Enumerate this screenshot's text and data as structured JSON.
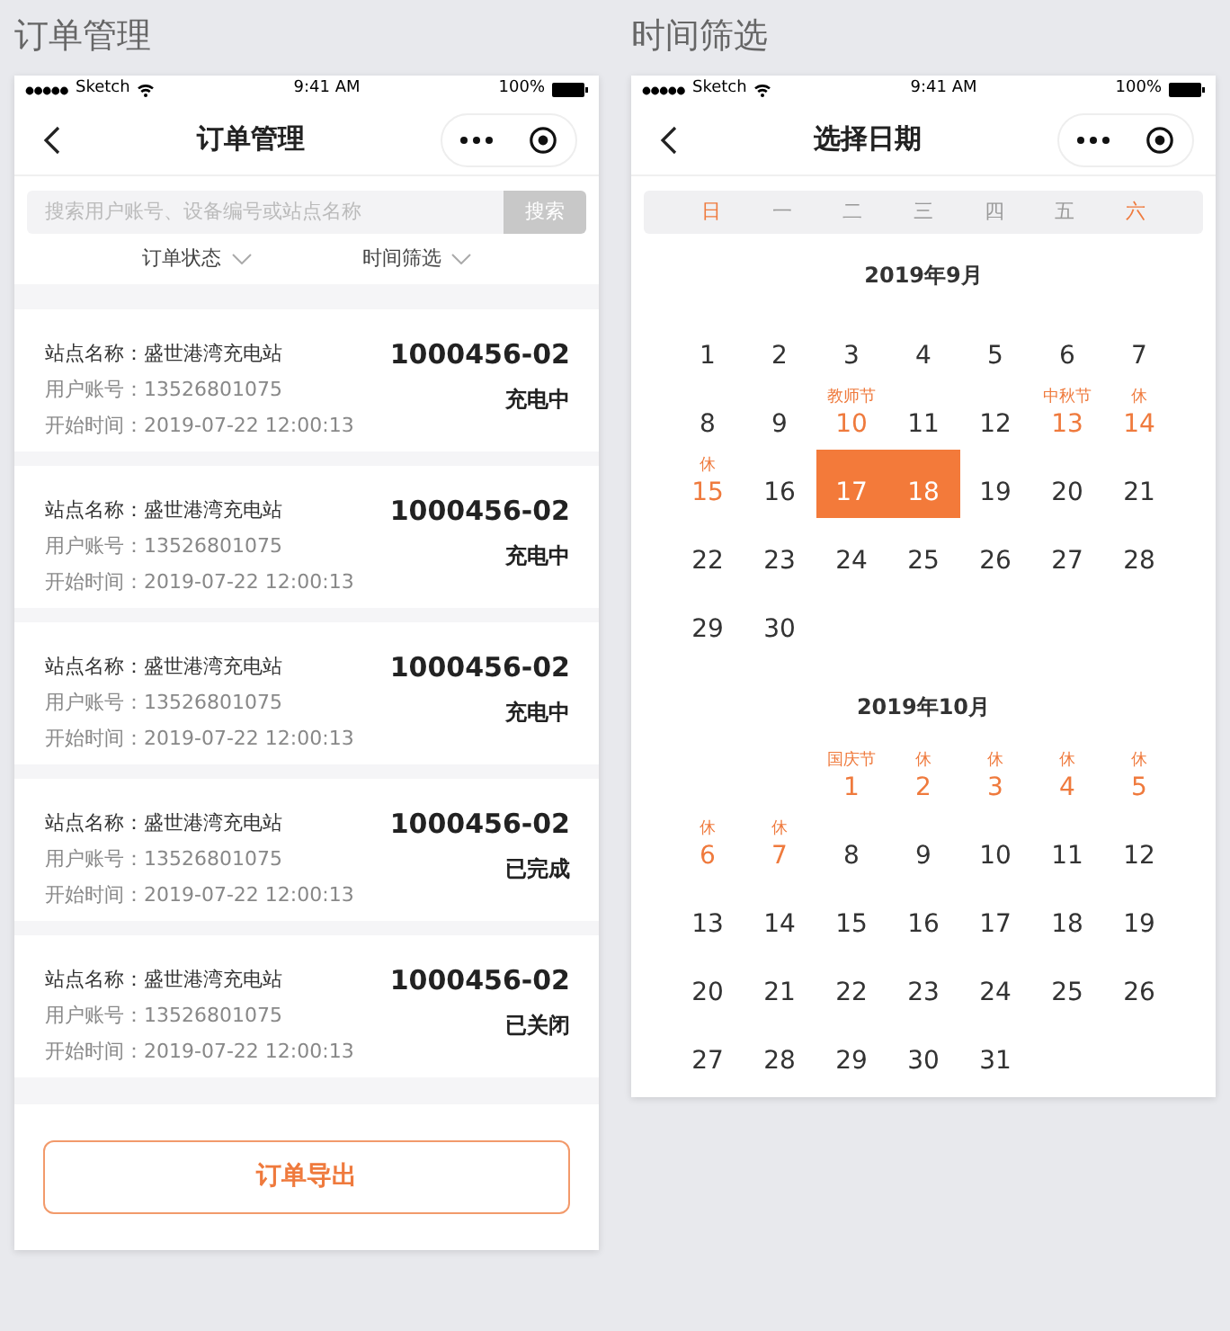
{
  "order_screen": {
    "caption": "订单管理",
    "status_bar": {
      "carrier": "Sketch",
      "time": "9:41 AM",
      "battery": "100%"
    },
    "nav": {
      "title": "订单管理"
    },
    "search": {
      "placeholder": "搜索用户账号、设备编号或站点名称",
      "button": "搜索"
    },
    "filters": [
      {
        "label": "订单状态"
      },
      {
        "label": "时间筛选"
      }
    ],
    "orders": [
      {
        "station": "站点名称：盛世港湾充电站",
        "account": "用户账号：13526801075",
        "start_time": "开始时间：2019-07-22 12:00:13",
        "order_no": "1000456-02",
        "status": "充电中"
      },
      {
        "station": "站点名称：盛世港湾充电站",
        "account": "用户账号：13526801075",
        "start_time": "开始时间：2019-07-22 12:00:13",
        "order_no": "1000456-02",
        "status": "充电中"
      },
      {
        "station": "站点名称：盛世港湾充电站",
        "account": "用户账号：13526801075",
        "start_time": "开始时间：2019-07-22 12:00:13",
        "order_no": "1000456-02",
        "status": "充电中"
      },
      {
        "station": "站点名称：盛世港湾充电站",
        "account": "用户账号：13526801075",
        "start_time": "开始时间：2019-07-22 12:00:13",
        "order_no": "1000456-02",
        "status": "已完成"
      },
      {
        "station": "站点名称：盛世港湾充电站",
        "account": "用户账号：13526801075",
        "start_time": "开始时间：2019-07-22 12:00:13",
        "order_no": "1000456-02",
        "status": "已关闭"
      }
    ],
    "export_button": "订单导出"
  },
  "date_screen": {
    "caption": "时间筛选",
    "status_bar": {
      "carrier": "Sketch",
      "time": "9:41 AM",
      "battery": "100%"
    },
    "nav": {
      "title": "选择日期"
    },
    "weekdays": [
      {
        "label": "日",
        "weekend": true
      },
      {
        "label": "一",
        "weekend": false
      },
      {
        "label": "二",
        "weekend": false
      },
      {
        "label": "三",
        "weekend": false
      },
      {
        "label": "四",
        "weekend": false
      },
      {
        "label": "五",
        "weekend": false
      },
      {
        "label": "六",
        "weekend": true
      }
    ],
    "months": [
      {
        "title": "2019年9月",
        "weeks": [
          [
            {
              "day": "1",
              "selected": false
            },
            {
              "day": "2",
              "selected": false
            },
            {
              "day": "3",
              "selected": false
            },
            {
              "day": "4",
              "selected": false
            },
            {
              "day": "5",
              "selected": false
            },
            {
              "day": "6",
              "selected": false
            },
            {
              "day": "7",
              "selected": false
            }
          ],
          [
            {
              "day": "8",
              "selected": false
            },
            {
              "day": "9",
              "selected": false
            },
            {
              "day": "10",
              "note": "教师节",
              "selected": false
            },
            {
              "day": "11",
              "selected": false
            },
            {
              "day": "12",
              "selected": false
            },
            {
              "day": "13",
              "note": "中秋节",
              "selected": false
            },
            {
              "day": "14",
              "note": "休",
              "selected": false
            }
          ],
          [
            {
              "day": "15",
              "note": "休",
              "selected": false
            },
            {
              "day": "16",
              "selected": false
            },
            {
              "day": "17",
              "selected": true
            },
            {
              "day": "18",
              "selected": true
            },
            {
              "day": "19",
              "selected": false
            },
            {
              "day": "20",
              "selected": false
            },
            {
              "day": "21",
              "selected": false
            }
          ],
          [
            {
              "day": "22",
              "selected": false
            },
            {
              "day": "23",
              "selected": false
            },
            {
              "day": "24",
              "selected": false
            },
            {
              "day": "25",
              "selected": false
            },
            {
              "day": "26",
              "selected": false
            },
            {
              "day": "27",
              "selected": false
            },
            {
              "day": "28",
              "selected": false
            }
          ],
          [
            {
              "day": "29",
              "selected": false
            },
            {
              "day": "30",
              "selected": false
            }
          ]
        ]
      },
      {
        "title": "2019年10月",
        "weeks": [
          [
            {
              "day": "1",
              "note": "国庆节",
              "selected": false
            },
            {
              "day": "2",
              "note": "休",
              "selected": false
            },
            {
              "day": "3",
              "note": "休",
              "selected": false
            },
            {
              "day": "4",
              "note": "休",
              "selected": false
            },
            {
              "day": "5",
              "note": "休",
              "selected": false
            }
          ],
          [
            {
              "day": "6",
              "note": "休",
              "selected": false
            },
            {
              "day": "7",
              "note": "休",
              "selected": false
            },
            {
              "day": "8",
              "selected": false
            },
            {
              "day": "9",
              "selected": false
            },
            {
              "day": "10",
              "selected": false
            },
            {
              "day": "11",
              "selected": false
            },
            {
              "day": "12",
              "selected": false
            }
          ],
          [
            {
              "day": "13",
              "selected": false
            },
            {
              "day": "14",
              "selected": false
            },
            {
              "day": "15",
              "selected": false
            },
            {
              "day": "16",
              "selected": false
            },
            {
              "day": "17",
              "selected": false
            },
            {
              "day": "18",
              "selected": false
            },
            {
              "day": "19",
              "selected": false
            }
          ],
          [
            {
              "day": "20",
              "selected": false
            },
            {
              "day": "21",
              "selected": false
            },
            {
              "day": "22",
              "selected": false
            },
            {
              "day": "23",
              "selected": false
            },
            {
              "day": "24",
              "selected": false
            },
            {
              "day": "25",
              "selected": false
            },
            {
              "day": "26",
              "selected": false
            }
          ],
          [
            {
              "day": "27",
              "selected": false
            },
            {
              "day": "28",
              "selected": false
            },
            {
              "day": "29",
              "selected": false
            },
            {
              "day": "30",
              "selected": false
            },
            {
              "day": "31",
              "selected": false
            }
          ]
        ]
      }
    ]
  }
}
